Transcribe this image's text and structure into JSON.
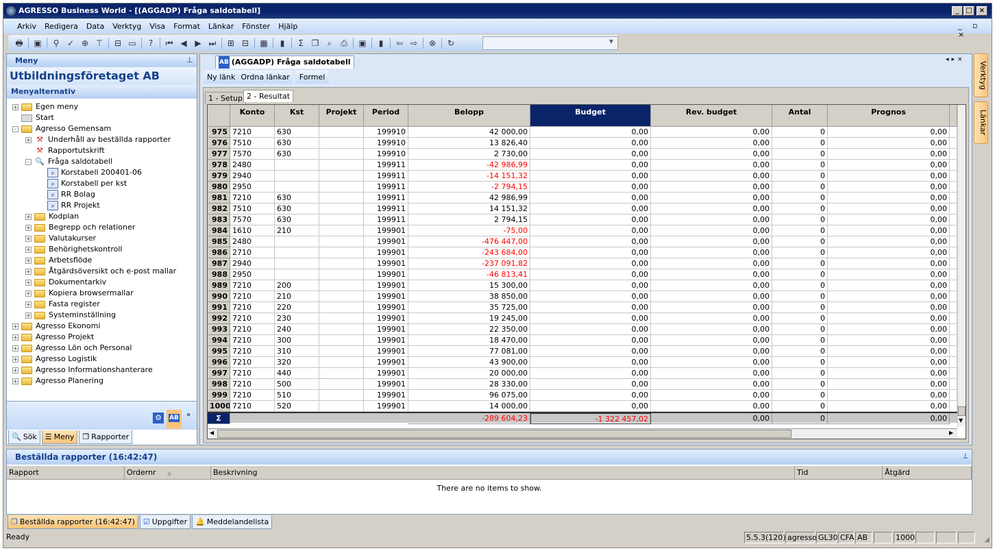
{
  "window": {
    "title": "AGRESSO Business World - [(AGGADP) Fråga saldotabell]"
  },
  "menu": [
    "Arkiv",
    "Redigera",
    "Data",
    "Verktyg",
    "Visa",
    "Format",
    "Länkar",
    "Fönster",
    "Hjälp"
  ],
  "toolbar_icons": [
    "print-icon",
    "save-icon",
    "binoculars-icon",
    "check-icon",
    "zoom-icon",
    "tree-icon",
    "insert-row-icon",
    "blank-icon",
    "help-icon",
    "first-icon",
    "prev-icon",
    "next-icon",
    "last-icon",
    "group-icon",
    "ungroup-icon",
    "table-icon",
    "chart-icon",
    "sum-icon",
    "copy-icon",
    "preview-icon",
    "print-preview-icon",
    "window-icon",
    "crayons-icon",
    "back-icon",
    "forward-icon",
    "stop-icon",
    "refresh-icon"
  ],
  "left_panel": {
    "header": "Meny",
    "company": "Utbildningsföretaget AB",
    "section": "Menyalternativ",
    "tree": [
      {
        "label": "Egen meny",
        "level": 0,
        "type": "folder",
        "exp": "+"
      },
      {
        "label": "Start",
        "level": 0,
        "type": "folder-grey",
        "exp": ""
      },
      {
        "label": "Agresso Gemensam",
        "level": 0,
        "type": "folder",
        "exp": "-"
      },
      {
        "label": "Underhåll av beställda rapporter",
        "level": 1,
        "type": "tool",
        "exp": "+"
      },
      {
        "label": "Rapportutskrift",
        "level": 1,
        "type": "tool",
        "exp": ""
      },
      {
        "label": "Fråga saldotabell",
        "level": 1,
        "type": "search",
        "exp": "-"
      },
      {
        "label": "Korstabell 200401-06",
        "level": 2,
        "type": "query",
        "exp": ""
      },
      {
        "label": "Korstabell per kst",
        "level": 2,
        "type": "query",
        "exp": ""
      },
      {
        "label": "RR Bolag",
        "level": 2,
        "type": "query",
        "exp": ""
      },
      {
        "label": "RR Projekt",
        "level": 2,
        "type": "query",
        "exp": ""
      },
      {
        "label": "Kodplan",
        "level": 1,
        "type": "folder",
        "exp": "+"
      },
      {
        "label": "Begrepp och relationer",
        "level": 1,
        "type": "folder",
        "exp": "+"
      },
      {
        "label": "Valutakurser",
        "level": 1,
        "type": "folder",
        "exp": "+"
      },
      {
        "label": "Behörighetskontroll",
        "level": 1,
        "type": "folder",
        "exp": "+"
      },
      {
        "label": "Arbetsflöde",
        "level": 1,
        "type": "folder",
        "exp": "+"
      },
      {
        "label": "Åtgärdsöversikt och e-post mallar",
        "level": 1,
        "type": "folder",
        "exp": "+"
      },
      {
        "label": "Dokumentarkiv",
        "level": 1,
        "type": "folder",
        "exp": "+"
      },
      {
        "label": "Kopiera browsermallar",
        "level": 1,
        "type": "folder",
        "exp": "+"
      },
      {
        "label": "Fasta register",
        "level": 1,
        "type": "folder",
        "exp": "+"
      },
      {
        "label": "Systeminställning",
        "level": 1,
        "type": "folder",
        "exp": "+"
      },
      {
        "label": "Agresso Ekonomi",
        "level": 0,
        "type": "folder",
        "exp": "+"
      },
      {
        "label": "Agresso Projekt",
        "level": 0,
        "type": "folder",
        "exp": "+"
      },
      {
        "label": "Agresso Lön och Personal",
        "level": 0,
        "type": "folder",
        "exp": "+"
      },
      {
        "label": "Agresso Logistik",
        "level": 0,
        "type": "folder",
        "exp": "+"
      },
      {
        "label": "Agresso Informationshanterare",
        "level": 0,
        "type": "folder",
        "exp": "+"
      },
      {
        "label": "Agresso Planering",
        "level": 0,
        "type": "folder",
        "exp": "+"
      }
    ],
    "tabs": [
      "Sök",
      "Meny",
      "Rapporter"
    ],
    "active_tab": "Meny"
  },
  "document": {
    "tab": "(AGGADP) Fråga saldotabell",
    "links": [
      "Ny länk",
      "Ordna länkar",
      "Formel"
    ],
    "subtabs": [
      "1 - Setup",
      "2 - Resultat"
    ],
    "active_subtab": "2 - Resultat"
  },
  "grid": {
    "columns": [
      "Konto",
      "Kst",
      "Projekt",
      "Period",
      "Belopp",
      "Budget",
      "Rev. budget",
      "Antal",
      "Prognos"
    ],
    "selected_column": "Budget",
    "rows": [
      [
        "975",
        "7210",
        "630",
        "",
        "199910",
        "42 000,00"
      ],
      [
        "976",
        "7510",
        "630",
        "",
        "199910",
        "13 826,40"
      ],
      [
        "977",
        "7570",
        "630",
        "",
        "199910",
        "2 730,00"
      ],
      [
        "978",
        "2480",
        "",
        "",
        "199911",
        "-42 986,99"
      ],
      [
        "979",
        "2940",
        "",
        "",
        "199911",
        "-14 151,32"
      ],
      [
        "980",
        "2950",
        "",
        "",
        "199911",
        "-2 794,15"
      ],
      [
        "981",
        "7210",
        "630",
        "",
        "199911",
        "42 986,99"
      ],
      [
        "982",
        "7510",
        "630",
        "",
        "199911",
        "14 151,32"
      ],
      [
        "983",
        "7570",
        "630",
        "",
        "199911",
        "2 794,15"
      ],
      [
        "984",
        "1610",
        "210",
        "",
        "199901",
        "-75,00"
      ],
      [
        "985",
        "2480",
        "",
        "",
        "199901",
        "-476 447,00"
      ],
      [
        "986",
        "2710",
        "",
        "",
        "199901",
        "-243 684,00"
      ],
      [
        "987",
        "2940",
        "",
        "",
        "199901",
        "-237 091,82"
      ],
      [
        "988",
        "2950",
        "",
        "",
        "199901",
        "-46 813,41"
      ],
      [
        "989",
        "7210",
        "200",
        "",
        "199901",
        "15 300,00"
      ],
      [
        "990",
        "7210",
        "210",
        "",
        "199901",
        "38 850,00"
      ],
      [
        "991",
        "7210",
        "220",
        "",
        "199901",
        "35 725,00"
      ],
      [
        "992",
        "7210",
        "230",
        "",
        "199901",
        "19 245,00"
      ],
      [
        "993",
        "7210",
        "240",
        "",
        "199901",
        "22 350,00"
      ],
      [
        "994",
        "7210",
        "300",
        "",
        "199901",
        "18 470,00"
      ],
      [
        "995",
        "7210",
        "310",
        "",
        "199901",
        "77 081,00"
      ],
      [
        "996",
        "7210",
        "320",
        "",
        "199901",
        "43 900,00"
      ],
      [
        "997",
        "7210",
        "440",
        "",
        "199901",
        "20 000,00"
      ],
      [
        "998",
        "7210",
        "500",
        "",
        "199901",
        "28 330,00"
      ],
      [
        "999",
        "7210",
        "510",
        "",
        "199901",
        "96 075,00"
      ],
      [
        "1000",
        "7210",
        "520",
        "",
        "199901",
        "14 000,00"
      ]
    ],
    "row_defaults": {
      "budget": "0,00",
      "rev_budget": "0,00",
      "antal": "0",
      "prognos": "0,00"
    },
    "sum": {
      "symbol": "Σ",
      "belopp": "-289 604,23",
      "budget": "-1 322 457,02",
      "rev_budget": "0,00",
      "antal": "0",
      "prognos": "0,00"
    }
  },
  "right_tabs": [
    "Verktyg",
    "Länkar"
  ],
  "bottom": {
    "title": "Beställda rapporter (16:42:47)",
    "columns": [
      "Rapport",
      "Ordernr",
      "Beskrivning",
      "Tid",
      "Åtgärd"
    ],
    "empty": "There are no items to show.",
    "tabs": [
      "Beställda rapporter (16:42:47)",
      "Uppgifter",
      "Meddelandelista"
    ]
  },
  "status": {
    "text": "Ready",
    "panels": [
      "5.5.3(120)",
      "agresso",
      "GL30",
      "CFA",
      "AB",
      "",
      "1000",
      "",
      "",
      ""
    ]
  },
  "colors": {
    "titlebar": "#0a246a",
    "negative": "#ff0000",
    "selected_header": "#0a246a",
    "panel_header": "#15428b"
  }
}
